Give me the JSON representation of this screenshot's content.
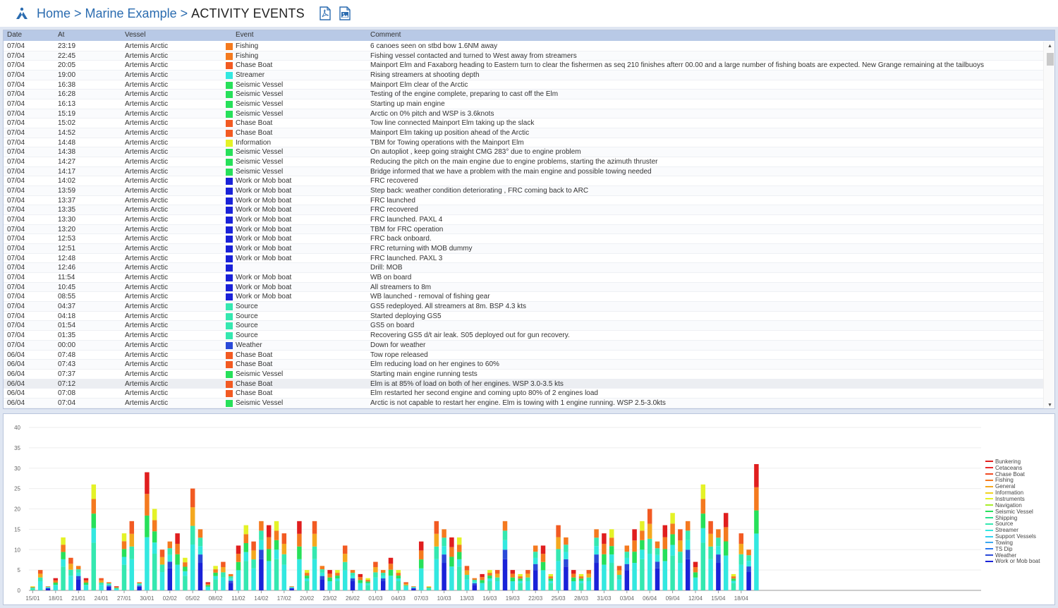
{
  "breadcrumb": {
    "home": "Home",
    "sep": ">",
    "section": "Marine Example",
    "current": "ACTIVITY EVENTS"
  },
  "table": {
    "headers": {
      "date": "Date",
      "at": "At",
      "vessel": "Vessel",
      "event": "Event",
      "comment": "Comment"
    },
    "rows": [
      [
        "07/04",
        "23:19",
        "Artemis Arctic",
        "Fishing",
        "6 canoes seen on stbd bow 1.6NM away"
      ],
      [
        "07/04",
        "22:45",
        "Artemis Arctic",
        "Fishing",
        "Fishing vessel contacted and turned to West away from streamers"
      ],
      [
        "07/04",
        "20:05",
        "Artemis Arctic",
        "Chase Boat",
        "Mainport Elm and Faxaborg heading to Eastern turn to clear the fishermen as seq 210 finishes afterr 00.00 and a large number of fishing boats are expected. New Grange remaining at the tailbuoys"
      ],
      [
        "07/04",
        "19:00",
        "Artemis Arctic",
        "Streamer",
        "Rising streamers at shooting depth"
      ],
      [
        "07/04",
        "16:38",
        "Artemis Arctic",
        "Seismic Vessel",
        "Mainport Elm clear of the Arctic"
      ],
      [
        "07/04",
        "16:28",
        "Artemis Arctic",
        "Seismic Vessel",
        "Testing of the engine complete, preparing to cast off the Elm"
      ],
      [
        "07/04",
        "16:13",
        "Artemis Arctic",
        "Seismic Vessel",
        "Starting up main engine"
      ],
      [
        "07/04",
        "15:19",
        "Artemis Arctic",
        "Seismic Vessel",
        "Arctic on 0% pitch and WSP is 3.6knots"
      ],
      [
        "07/04",
        "15:02",
        "Artemis Arctic",
        "Chase Boat",
        "Tow line connected Mainport Elm taking up the slack"
      ],
      [
        "07/04",
        "14:52",
        "Artemis Arctic",
        "Chase Boat",
        "Mainport Elm taking up position ahead of the Arctic"
      ],
      [
        "07/04",
        "14:48",
        "Artemis Arctic",
        "Information",
        "TBM for Towing operations with the Mainport Elm"
      ],
      [
        "07/04",
        "14:38",
        "Artemis Arctic",
        "Seismic Vessel",
        "On autopliot , keep going straight CMG 283° due to engine problem"
      ],
      [
        "07/04",
        "14:27",
        "Artemis Arctic",
        "Seismic Vessel",
        "Reducing the pitch on the main engine due to engine problems, starting the azimuth thruster"
      ],
      [
        "07/04",
        "14:17",
        "Artemis Arctic",
        "Seismic Vessel",
        "Bridge informed that we have a problem with the main engine and possible towing needed"
      ],
      [
        "07/04",
        "14:02",
        "Artemis Arctic",
        "Work or Mob boat",
        "FRC recovered"
      ],
      [
        "07/04",
        "13:59",
        "Artemis Arctic",
        "Work or Mob boat",
        "Step back: weather condition deteriorating , FRC coming back to ARC"
      ],
      [
        "07/04",
        "13:37",
        "Artemis Arctic",
        "Work or Mob boat",
        "FRC launched"
      ],
      [
        "07/04",
        "13:35",
        "Artemis Arctic",
        "Work or Mob boat",
        "FRC recovered"
      ],
      [
        "07/04",
        "13:30",
        "Artemis Arctic",
        "Work or Mob boat",
        "FRC launched. PAXL 4"
      ],
      [
        "07/04",
        "13:20",
        "Artemis Arctic",
        "Work or Mob boat",
        "TBM for FRC operation"
      ],
      [
        "07/04",
        "12:53",
        "Artemis Arctic",
        "Work or Mob boat",
        "FRC back onboard."
      ],
      [
        "07/04",
        "12:51",
        "Artemis Arctic",
        "Work or Mob boat",
        "FRC returning with MOB dummy"
      ],
      [
        "07/04",
        "12:48",
        "Artemis Arctic",
        "Work or Mob boat",
        "FRC launched. PAXL 3"
      ],
      [
        "07/04",
        "12:46",
        "Artemis Arctic",
        "",
        "Drill: MOB"
      ],
      [
        "07/04",
        "11:54",
        "Artemis Arctic",
        "Work or Mob boat",
        "WB on board"
      ],
      [
        "07/04",
        "10:45",
        "Artemis Arctic",
        "Work or Mob boat",
        "All streamers to 8m"
      ],
      [
        "07/04",
        "08:55",
        "Artemis Arctic",
        "Work or Mob boat",
        "WB launched - removal of fishing gear"
      ],
      [
        "07/04",
        "04:37",
        "Artemis Arctic",
        "Source",
        "GS5 redeployed. All streamers at 8m. BSP 4.3 kts"
      ],
      [
        "07/04",
        "04:18",
        "Artemis Arctic",
        "Source",
        "Started deploying GS5"
      ],
      [
        "07/04",
        "01:54",
        "Artemis Arctic",
        "Source",
        "GS5 on board"
      ],
      [
        "07/04",
        "01:35",
        "Artemis Arctic",
        "Source",
        "Recovering GS5 d/t air leak. S05 deployed out for gun recovery."
      ],
      [
        "07/04",
        "00:00",
        "Artemis Arctic",
        "Weather",
        "Down for weather"
      ],
      [
        "06/04",
        "07:48",
        "Artemis Arctic",
        "Chase Boat",
        "Tow rope released"
      ],
      [
        "06/04",
        "07:43",
        "Artemis Arctic",
        "Chase Boat",
        "Elm reducing load on her engines to 60%"
      ],
      [
        "06/04",
        "07:37",
        "Artemis Arctic",
        "Seismic Vessel",
        "Starting main engine running tests"
      ],
      [
        "06/04",
        "07:12",
        "Artemis Arctic",
        "Chase Boat",
        "Elm is at 85% of load on both of her engines. WSP 3.0-3.5 kts"
      ],
      [
        "06/04",
        "07:08",
        "Artemis Arctic",
        "Chase Boat",
        "Elm restarted her second engine and coming upto 80% of 2 engines load"
      ],
      [
        "06/04",
        "07:04",
        "Artemis Arctic",
        "Seismic Vessel",
        "Arctic is not capable to restart her engine. Elm is towing with 1 engine running. WSP 2.5-3.0kts"
      ]
    ],
    "swatch_colors": [
      "#f47a1f",
      "#f47a1f",
      "#f25a22",
      "#33e8e0",
      "#27e05a",
      "#27e05a",
      "#27e05a",
      "#27e05a",
      "#f25a22",
      "#f25a22",
      "#e4f227",
      "#27e05a",
      "#27e05a",
      "#27e05a",
      "#1a22d8",
      "#1a22d8",
      "#1a22d8",
      "#1a22d8",
      "#1a22d8",
      "#1a22d8",
      "#1a22d8",
      "#1a22d8",
      "#1a22d8",
      "#1a22d8",
      "#1a22d8",
      "#1a22d8",
      "#1a22d8",
      "#35e8b0",
      "#35e8b0",
      "#35e8b0",
      "#35e8b0",
      "#2a4ad8",
      "#f25a22",
      "#f25a22",
      "#27e05a",
      "#f25a22",
      "#f25a22",
      "#27e05a"
    ]
  },
  "chart_data": {
    "type": "bar",
    "stacked": true,
    "ylim": [
      0,
      40
    ],
    "yticks": [
      0,
      5,
      10,
      15,
      20,
      25,
      30,
      35,
      40
    ],
    "xtick_labels": [
      "15/01",
      "18/01",
      "21/01",
      "24/01",
      "27/01",
      "30/01",
      "02/02",
      "05/02",
      "08/02",
      "11/02",
      "14/02",
      "17/02",
      "20/02",
      "23/02",
      "26/02",
      "01/03",
      "04/03",
      "07/03",
      "10/03",
      "13/03",
      "16/03",
      "19/03",
      "22/03",
      "25/03",
      "28/03",
      "31/03",
      "03/04",
      "06/04",
      "09/04",
      "12/04",
      "15/04",
      "18/04"
    ],
    "start_date": "15/01",
    "totals": [
      1,
      5,
      1,
      3,
      13,
      8,
      6,
      3,
      26,
      3,
      2,
      1,
      14,
      17,
      2,
      29,
      20,
      10,
      12,
      14,
      8,
      25,
      15,
      2,
      6,
      7,
      4,
      11,
      16,
      12,
      17,
      16,
      17,
      14,
      1,
      17,
      5,
      17,
      6,
      5,
      5,
      11,
      5,
      4,
      3,
      7,
      5,
      8,
      5,
      2,
      1,
      12,
      1,
      17,
      15,
      13,
      13,
      6,
      3,
      4,
      5,
      5,
      17,
      5,
      4,
      5,
      11,
      11,
      4,
      16,
      13,
      5,
      4,
      5,
      15,
      14,
      15,
      6,
      11,
      15,
      17,
      20,
      12,
      16,
      19,
      15,
      17,
      7,
      26,
      17,
      15,
      19,
      4,
      14,
      10,
      31,
      0,
      0,
      0,
      0,
      0,
      0,
      0,
      0,
      0,
      0,
      0,
      0,
      0,
      0,
      0,
      0,
      0,
      0,
      0,
      0,
      0,
      0,
      0,
      0,
      0,
      0,
      0,
      0,
      0
    ],
    "legend": [
      "Bunkering",
      "Cetaceans",
      "Chase Boat",
      "Fishing",
      "General",
      "Information",
      "Instruments",
      "Navigation",
      "Seismic Vessel",
      "Shipping",
      "Source",
      "Streamer",
      "Support Vessels",
      "Towing",
      "TS Dip",
      "Weather",
      "Work or Mob boat"
    ],
    "legend_colors": [
      "#e01e1e",
      "#ea2a2a",
      "#f04a22",
      "#f47a1f",
      "#f4a81f",
      "#f2d21f",
      "#e4f227",
      "#a8ee2a",
      "#27e05a",
      "#2ae08a",
      "#35e8b0",
      "#33e8e0",
      "#33d0f0",
      "#3aa8f0",
      "#2a78f0",
      "#2a4ad8",
      "#1a22d8"
    ]
  }
}
